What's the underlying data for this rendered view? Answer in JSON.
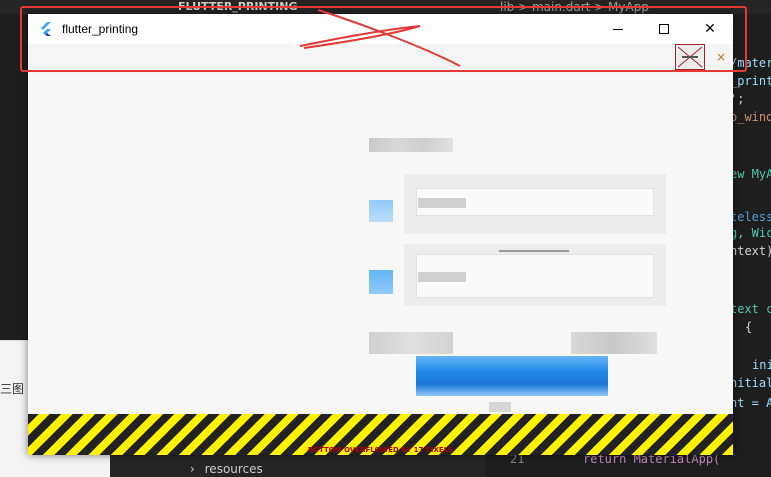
{
  "ide": {
    "explorer_title": "FLUTTER_PRINTING",
    "breadcrumb": "lib > main.dart > MyApp",
    "left_panel_text": "三图",
    "tree_item": "resources",
    "line_number": "21",
    "code_return": "return MaterialApp(",
    "code_lines": [
      {
        "text": "/mater",
        "color": "#9cdcfe"
      },
      {
        "text": "_print",
        "color": "#9cdcfe"
      },
      {
        "text": "';",
        "color": "#d4d4d4"
      },
      {
        "text": "o_wind",
        "color": "#ce9178"
      },
      {
        "text": "ew MyA",
        "color": "#4ec9b0"
      },
      {
        "text": "teless",
        "color": "#569cd6"
      },
      {
        "text": "g, Wic",
        "color": "#4ec9b0"
      },
      {
        "text": "ntext)",
        "color": "#d4d4d4"
      },
      {
        "text": "text c",
        "color": "#4ec9b0"
      },
      {
        "text": "{",
        "color": "#d4d4d4"
      },
      {
        "text": "ini",
        "color": "#9cdcfe"
      },
      {
        "text": "nitial",
        "color": "#9cdcfe"
      },
      {
        "text": "nt = A",
        "color": "#9cdcfe"
      }
    ]
  },
  "window": {
    "title": "flutter_printing",
    "min_icon": "minimize-icon",
    "max_icon": "maximize-icon",
    "close_icon": "close-icon",
    "close_glyph": "✕"
  },
  "debug": {
    "close_glyph": "×"
  },
  "content": {
    "overflow_message": "BOTTOM OVERFLOWED BY 17 PIXELS"
  },
  "colors": {
    "annotation": "#e53935",
    "stripe_yellow": "#fff200",
    "stripe_dark": "#222222",
    "blue": "#2196f3"
  }
}
